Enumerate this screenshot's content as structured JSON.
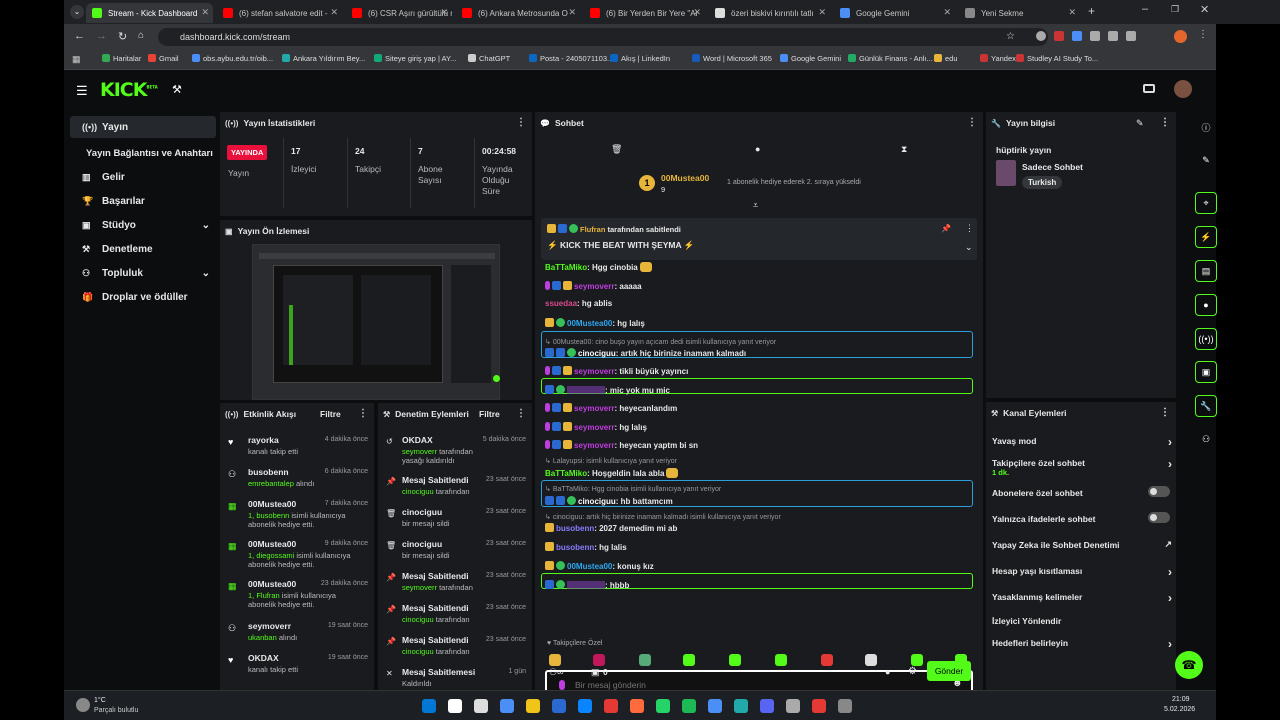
{
  "browser": {
    "tabs": [
      {
        "title": "Stream - Kick Dashboard",
        "active": true,
        "color": "#53fc18"
      },
      {
        "title": "(6) stefan salvatore edit -",
        "color": "#ff0000"
      },
      {
        "title": "(6) CSR Aşırı gürültülü mo",
        "color": "#ff0000"
      },
      {
        "title": "(6) Ankara Metrosunda O",
        "color": "#ff0000"
      },
      {
        "title": "(6) Bir Yerden Bir Yere \"Ar",
        "color": "#ff0000"
      },
      {
        "title": "özeri biskivi kırıntılı tatlı",
        "color": "#dddddd"
      },
      {
        "title": "Google Gemini",
        "color": "#4b8ef5"
      },
      {
        "title": "Yeni Sekme",
        "color": "#888888"
      }
    ],
    "url": "dashboard.kick.com/stream",
    "bookmarks": [
      "Haritalar",
      "Gmail",
      "obs.aybu.edu.tr/oib...",
      "Ankara Yıldırım Bey...",
      "Siteye giriş yap | AY...",
      "ChatGPT",
      "Posta - 2405071103...",
      "Akış | LinkedIn",
      "Word | Microsoft 365",
      "Google Gemini",
      "Günlük Finans - Anlı...",
      "edu",
      "Yandex",
      "Studley AI Study To..."
    ]
  },
  "header": {
    "logo": "KICK",
    "beta": "BETA"
  },
  "sidebar": {
    "items": [
      {
        "label": "Yayın",
        "icon": "broadcast-icon"
      },
      {
        "label": "Yayın Bağlantısı ve Anahtarı"
      },
      {
        "label": "Gelir",
        "icon": "chart-icon"
      },
      {
        "label": "Başarılar",
        "icon": "trophy-icon"
      },
      {
        "label": "Stüdyo",
        "icon": "studio-icon"
      },
      {
        "label": "Denetleme",
        "icon": "hammer-icon"
      },
      {
        "label": "Topluluk",
        "icon": "people-icon"
      },
      {
        "label": "Droplar ve ödüller",
        "icon": "gift-icon"
      }
    ]
  },
  "stats": {
    "title": "Yayın İstatistikleri",
    "live_badge": "YAYINDA",
    "live_label": "Yayın",
    "viewers": "17",
    "viewers_label": "İzleyici",
    "followers": "24",
    "followers_label": "Takipçi",
    "subs": "7",
    "subs_label": "Abone Sayısı",
    "uptime": "00:24:58",
    "uptime_label": "Yayında Olduğu Süre"
  },
  "preview": {
    "title": "Yayın Ön İzlemesi"
  },
  "activity": {
    "title": "Etkinlik Akışı",
    "filter": "Filtre",
    "items": [
      {
        "name": "rayorka",
        "time": "4 dakika önce",
        "desc": "kanalı takip etti"
      },
      {
        "name": "busobenn",
        "time": "6 dakika önce",
        "hl": "emrebantalep",
        "desc": " alındı"
      },
      {
        "name": "00Mustea00",
        "time": "7 dakika önce",
        "hl": "1, busobenn",
        "desc": " isimli kullanıcıya abonelik hediye etti."
      },
      {
        "name": "00Mustea00",
        "time": "9 dakika önce",
        "hl": "1, diegossami",
        "desc": " isimli kullanıcıya abonelik hediye etti."
      },
      {
        "name": "00Mustea00",
        "time": "23 dakika önce",
        "hl": "1, Flufran",
        "desc": " isimli kullanıcıya abonelik hediye etti."
      },
      {
        "name": "seymoverr",
        "time": "19 saat önce",
        "hl": "ukanban",
        "desc": " alındı"
      },
      {
        "name": "OKDAX",
        "time": "19 saat önce",
        "desc": "kanalı takip etti"
      }
    ]
  },
  "moderation": {
    "title": "Denetim Eylemleri",
    "filter": "Filtre",
    "items": [
      {
        "name": "OKDAX",
        "time": "5 dakika önce",
        "hl": "seymoverr",
        "desc": " tarafından yasağı kaldırıldı"
      },
      {
        "name": "Mesaj Sabitlendi",
        "time": "23 saat önce",
        "hl": "cinociguu",
        "desc": " tarafından"
      },
      {
        "name": "cinociguu",
        "time": "23 saat önce",
        "desc": "bir mesajı sildi"
      },
      {
        "name": "cinociguu",
        "time": "23 saat önce",
        "desc": "bir mesajı sildi"
      },
      {
        "name": "Mesaj Sabitlendi",
        "time": "23 saat önce",
        "hl": "seymoverr",
        "desc": " tarafından"
      },
      {
        "name": "Mesaj Sabitlendi",
        "time": "23 saat önce",
        "hl": "cinociguu",
        "desc": " tarafından"
      },
      {
        "name": "Mesaj Sabitlendi",
        "time": "23 saat önce",
        "hl": "cinociguu",
        "desc": " tarafından"
      },
      {
        "name": "Mesaj Sabitlemesi",
        "time": "1 gün",
        "desc": "Kaldırıldı"
      }
    ]
  },
  "chat": {
    "title": "Sohbet",
    "top_user": "00Mustea00",
    "top_count": "9",
    "top_text": "1 abonelik hediye ederek 2. sıraya yükseldi",
    "pinned_by": "Flufran",
    "pinned_by_suffix": "tarafından sabitlendi",
    "pinned_text": "KICK THE BEAT WITH ŞEYMA",
    "messages": [
      {
        "user": "BaTTaMiko",
        "text": "Hgg cinobia"
      },
      {
        "user": "seymoverr",
        "text": "aaaaa"
      },
      {
        "user": "ssuedaa",
        "text": "hg ablis"
      },
      {
        "user": "00Mustea00",
        "text": "hg lalış"
      },
      {
        "reply": "00Mustea00: cino buşo yayın açıcam dedi isimli kullanıcıya yanıt veriyor",
        "user": "cinociguu",
        "text": "artık hiç birinize inamam kalmadı"
      },
      {
        "user": "seymoverr",
        "text": "tikli büyük yayıncı"
      },
      {
        "user": "",
        "text": "mic yok mu mic"
      },
      {
        "user": "seymoverr",
        "text": "heyecanlandım"
      },
      {
        "user": "seymoverr",
        "text": "hg lalış"
      },
      {
        "user": "seymoverr",
        "text": "heyecan yaptm bi sn"
      },
      {
        "reply": "Lalayupsi:  isimli kullanıcıya yanıt veriyor",
        "user": "BaTTaMiko",
        "text": "Hoşgeldin lala abla"
      },
      {
        "reply": "BaTTaMiko: Hgg cinobia  isimli kullanıcıya yanıt veriyor",
        "user": "cinociguu",
        "text": "hb battamcım"
      },
      {
        "reply": "cinociguu: artık hiç birinize inamam kalmadı isimli kullanıcıya yanıt veriyor",
        "user": "busobenn",
        "text": "2027 demedim mi ab"
      },
      {
        "user": "busobenn",
        "text": "hg lalis"
      },
      {
        "user": "00Mustea00",
        "text": "konuş kız"
      },
      {
        "user": "",
        "text": "hbbb"
      }
    ],
    "emote_tab": "Takipçilere Özel",
    "input_placeholder": "Bir mesaj gönderin",
    "points": "0",
    "send": "Gönder"
  },
  "stream_info": {
    "title": "Yayın bilgisi",
    "stream_title": "hüptirik yayın",
    "category": "Sadece Sohbet",
    "tag": "Turkish"
  },
  "channel_actions": {
    "title": "Kanal Eylemleri",
    "items": [
      {
        "label": "Yavaş mod",
        "ctrl": "chev"
      },
      {
        "label": "Takipçilere özel sohbet",
        "sub": "1 dk.",
        "ctrl": "chev"
      },
      {
        "label": "Abonelere özel sohbet",
        "ctrl": "toggle"
      },
      {
        "label": "Yalnızca ifadelerle sohbet",
        "ctrl": "toggle"
      },
      {
        "label": "Yapay Zeka ile Sohbet Denetimi",
        "ctrl": "ext"
      },
      {
        "label": "Hesap yaşı kısıtlaması",
        "ctrl": "chev"
      },
      {
        "label": "Yasaklanmış kelimeler",
        "ctrl": "chev"
      },
      {
        "label": "İzleyici Yönlendir",
        "ctrl": ""
      },
      {
        "label": "Hedefleri belirleyin",
        "ctrl": "chev"
      }
    ]
  },
  "taskbar": {
    "weather_temp": "1°C",
    "weather_desc": "Parçalı bulutlu",
    "time": "21:09",
    "date": "5.02.2026"
  }
}
